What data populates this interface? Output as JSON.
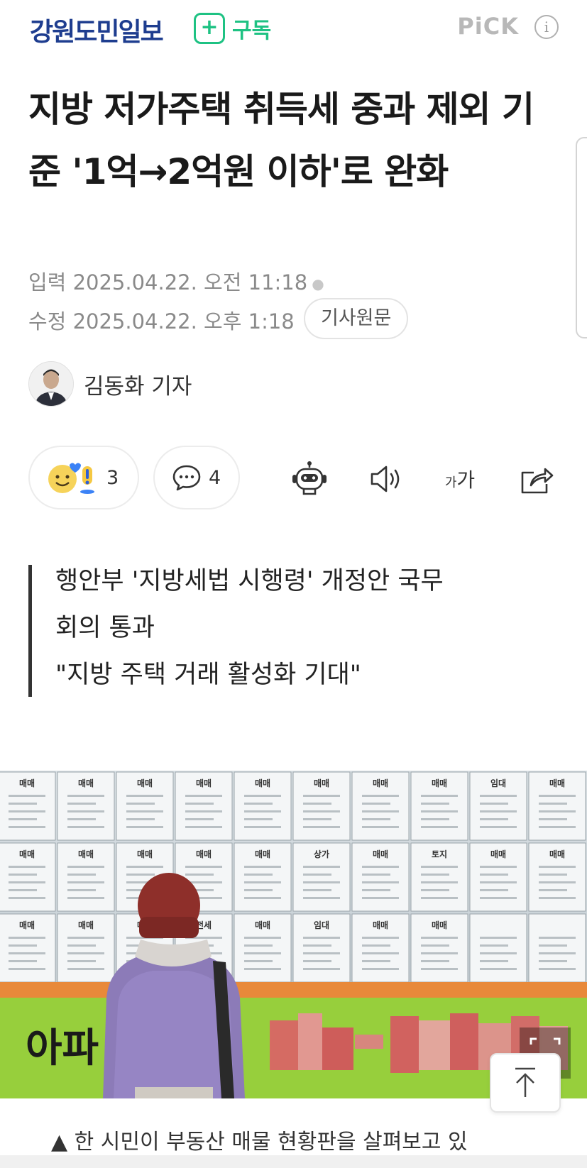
{
  "header": {
    "press_name": "강원도민일보",
    "subscribe_label": "구독",
    "pick_label": "PiCK"
  },
  "article": {
    "title": "지방 저가주택 취득세 중과 제외 기준 '1억→2억원 이하'로 완화",
    "published": "입력 2025.04.22. 오전 11:18",
    "modified": "수정 2025.04.22. 오후 1:18",
    "original_link_label": "기사원문",
    "reporter": "김동화 기자",
    "subheadline_lines": [
      "행안부 '지방세법 시행령' 개정안 국무",
      "회의 통과",
      "\"지방 주택 거래 활성화 기대\""
    ],
    "photo_caption": "▲ 한 시민이 부동산 매물 현황판을 살펴보고 있"
  },
  "actions": {
    "reaction_count": "3",
    "comment_count": "4",
    "font_size_label_small": "가",
    "font_size_label_large": "가"
  },
  "photo": {
    "banner_text": "아파",
    "board_labels": [
      "매매",
      "매매",
      "매매",
      "매매",
      "매매",
      "매매",
      "매매",
      "매매",
      "임대",
      "매매",
      "매매",
      "매매",
      "매매",
      "매매",
      "매매",
      "상가",
      "매매",
      "토지",
      "매매",
      "매매",
      "매매",
      "매매",
      "매매",
      "전세",
      "매매",
      "임대",
      "매매",
      "매매"
    ]
  },
  "colors": {
    "brand_blue": "#1e3d8f",
    "subscribe_green": "#1ec283",
    "muted_gray": "#8a8a8a"
  }
}
